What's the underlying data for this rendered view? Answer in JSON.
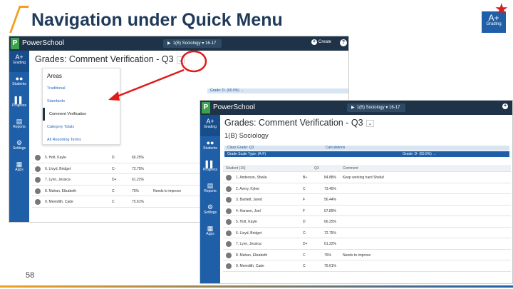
{
  "slide": {
    "title": "Navigation under Quick Menu",
    "page_number": "58",
    "badge": {
      "glyph": "A+",
      "label": "Grading"
    }
  },
  "icons": [
    "powerschool-logo-icon",
    "play-icon",
    "plus-icon",
    "help-icon",
    "grading-icon",
    "students-icon",
    "progress-icon",
    "reports-icon",
    "settings-icon",
    "apps-icon",
    "chevron-down-icon",
    "star-icon"
  ],
  "app": {
    "brand": "PowerSchool",
    "term": "1(B) Sociology",
    "term_range": "16-17",
    "create_label": "Create",
    "help": "?",
    "nav": [
      {
        "glyph": "A+",
        "label": "Grading"
      },
      {
        "glyph": "●●",
        "label": "Students"
      },
      {
        "glyph": "▌▌",
        "label": "Progress"
      },
      {
        "glyph": "▤",
        "label": "Reports"
      },
      {
        "glyph": "⚙",
        "label": "Settings"
      },
      {
        "glyph": "▦",
        "label": "Apps"
      }
    ]
  },
  "back_window": {
    "page_title": "Grades: Comment Verification - Q3",
    "menu": {
      "header": "Areas",
      "items": [
        "Traditional",
        "Standards",
        "Comment Verification",
        "Category Totals",
        "All Reporting Terms"
      ],
      "selected_index": 2
    },
    "grade_strip": "Grade: D-  (60.9%)  →",
    "rows": [
      {
        "name": "5. Holt, Kayle",
        "grade": "D",
        "pct": "66.25%"
      },
      {
        "name": "6. Lloyd, Bridget",
        "grade": "C-",
        "pct": "72.75%"
      },
      {
        "name": "7. Lynn, Jessica",
        "grade": "D+",
        "pct": "61.22%"
      },
      {
        "name": "8. Mahan, Elizabeth",
        "grade": "C",
        "pct": "75%",
        "comment": "Needs to improve"
      },
      {
        "name": "9. Meredith, Cade",
        "grade": "C",
        "pct": "75.61%"
      }
    ]
  },
  "front_window": {
    "page_title": "Grades: Comment Verification - Q3",
    "section": "1(B) Sociology",
    "class_grade": "Class Grade: Q3",
    "calculations": "Calculations",
    "scale_label": "Grade Scale Type: (A-F)",
    "grade_strip": "Grade: D-  (60.9%)  →",
    "headers": {
      "student": "Student (16)",
      "q3": "Q3",
      "comment": "Comment"
    },
    "rows": [
      {
        "name": "1. Anderson, Sheila",
        "grade": "B+",
        "pct": "84.88%",
        "comment": "Keep working hard Sheila!"
      },
      {
        "name": "2. Avery, Kylee",
        "grade": "C",
        "pct": "73.45%"
      },
      {
        "name": "3. Bartlett, Jared",
        "grade": "F",
        "pct": "56.44%"
      },
      {
        "name": "4. Hansen, Joel",
        "grade": "F",
        "pct": "57.89%"
      },
      {
        "name": "5. Holt, Kayle",
        "grade": "D",
        "pct": "66.25%"
      },
      {
        "name": "6. Lloyd, Bridget",
        "grade": "C-",
        "pct": "72.75%"
      },
      {
        "name": "7. Lynn, Jessica",
        "grade": "D+",
        "pct": "61.22%"
      },
      {
        "name": "8. Mahan, Elizabeth",
        "grade": "C",
        "pct": "75%",
        "comment": "Needs to improve"
      },
      {
        "name": "9. Meredith, Cade",
        "grade": "C",
        "pct": "75.61%"
      }
    ]
  }
}
